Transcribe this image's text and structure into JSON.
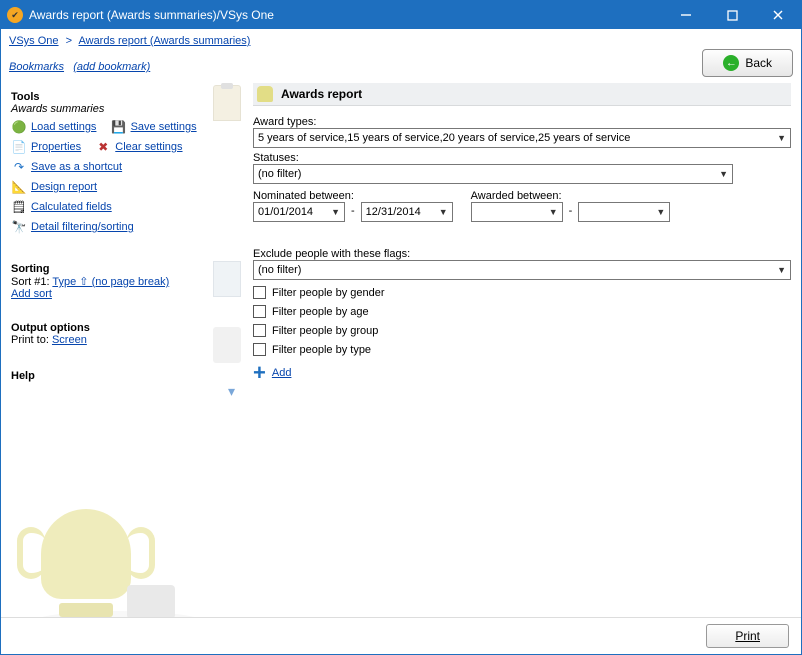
{
  "window": {
    "title": "Awards report (Awards summaries)/VSys One"
  },
  "breadcrumb": {
    "root": "VSys One",
    "current": "Awards report (Awards summaries)"
  },
  "bookmarks": {
    "label": "Bookmarks",
    "add": "(add bookmark)"
  },
  "back_button": "Back",
  "sidebar": {
    "tools_title": "Tools",
    "subtitle": "Awards summaries",
    "load_settings": "Load settings",
    "save_settings": "Save settings",
    "properties": "Properties",
    "clear_settings": "Clear settings",
    "save_shortcut": "Save as a shortcut",
    "design_report": "Design report",
    "calculated_fields": "Calculated fields",
    "detail_filtering": "Detail filtering/sorting",
    "sorting_title": "Sorting",
    "sort1_prefix": "Sort #1: ",
    "sort1_link": "Type ⇧ (no page break)",
    "add_sort": "Add sort",
    "output_title": "Output options",
    "print_to_label": "Print to:  ",
    "print_to_value": "Screen",
    "help_title": "Help"
  },
  "main": {
    "header": "Awards report",
    "award_types_label": "Award types:",
    "award_types_value": "5 years of service,15 years of service,20 years of service,25 years of service",
    "statuses_label": "Statuses:",
    "statuses_value": "(no filter)",
    "nominated_label": "Nominated between:",
    "nominated_from": "01/01/2014",
    "nominated_to": "12/31/2014",
    "awarded_label": "Awarded between:",
    "awarded_from": "",
    "awarded_to": "",
    "exclude_label": "Exclude people with these flags:",
    "exclude_value": "(no filter)",
    "checks": {
      "gender": "Filter people by gender",
      "age": "Filter people by age",
      "group": "Filter people by group",
      "type": "Filter people by type"
    },
    "add_label": "Add"
  },
  "footer": {
    "print": "Print"
  }
}
